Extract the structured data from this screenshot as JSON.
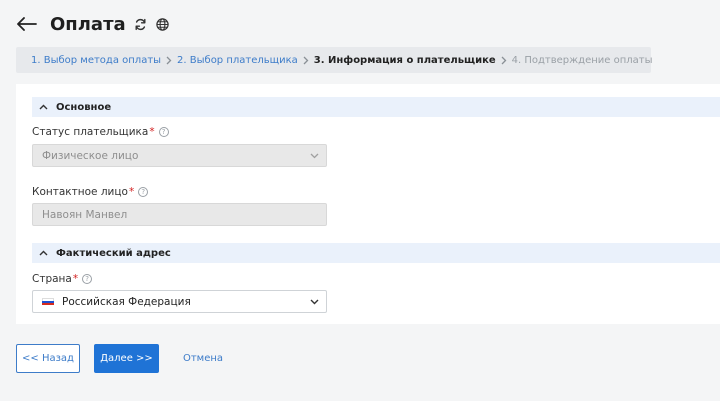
{
  "header": {
    "title": "Оплата",
    "back_icon": "arrow-left-icon",
    "refresh_icon": "refresh-icon",
    "globe_icon": "globe-icon"
  },
  "steps": [
    {
      "label": "1. Выбор метода оплаты",
      "state": "done"
    },
    {
      "label": "2. Выбор плательщика",
      "state": "done"
    },
    {
      "label": "3. Информация о плательщике",
      "state": "current"
    },
    {
      "label": "4. Подтверждение оплаты",
      "state": "future"
    }
  ],
  "sections": {
    "main": {
      "title": "Основное",
      "payer_status_label": "Статус плательщика",
      "payer_status_value": "Физическое лицо",
      "contact_label": "Контактное лицо",
      "contact_value": "Навоян Манвел"
    },
    "address": {
      "title": "Фактический адрес",
      "country_label": "Страна",
      "country_value": "Российская Федерация"
    }
  },
  "required_mark": "*",
  "help_mark": "?",
  "buttons": {
    "back": "<< Назад",
    "next": "Далее >>",
    "cancel": "Отмена"
  },
  "colors": {
    "accent": "#1f73d6",
    "link": "#3d7cc9",
    "section_bg": "#eaf1fb",
    "required": "#d32020"
  }
}
